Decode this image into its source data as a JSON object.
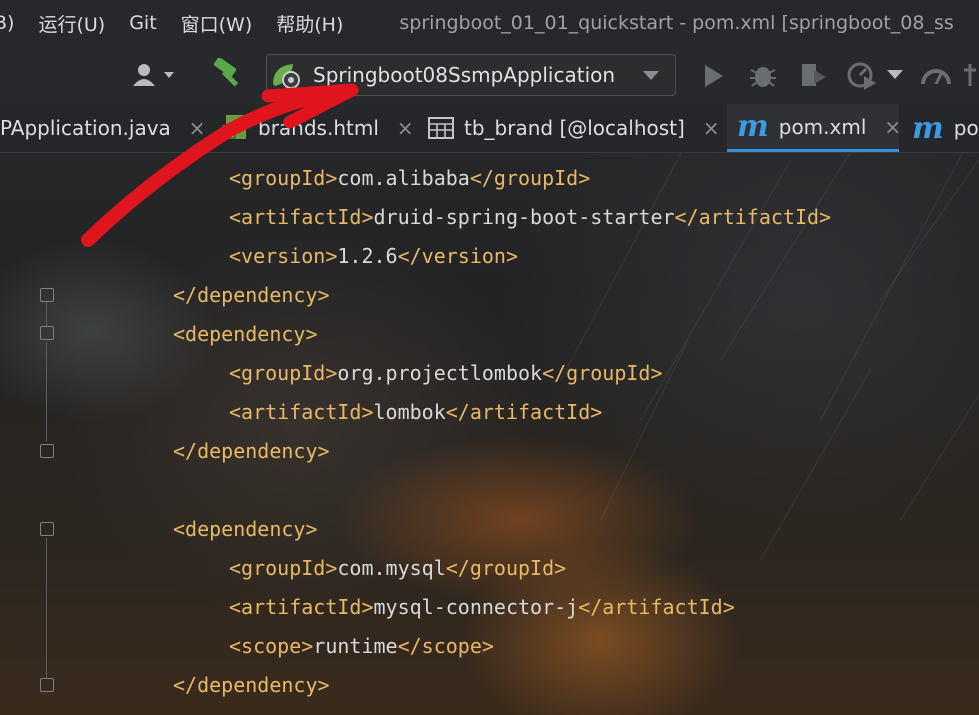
{
  "menubar": {
    "items": [
      {
        "label": "B)"
      },
      {
        "label": "运行(U)"
      },
      {
        "label": "Git"
      },
      {
        "label": "窗口(W)"
      },
      {
        "label": "帮助(H)"
      }
    ],
    "window_title": "springboot_01_01_quickstart - pom.xml [springboot_08_ss"
  },
  "toolbar": {
    "run_config": "Springboot08SsmpApplication",
    "icons": [
      "user-icon",
      "build-hammer-icon",
      "spring-boot-icon",
      "run-icon",
      "debug-icon",
      "coverage-icon",
      "profiler-icon",
      "more-run-icon",
      "performance-icon",
      "settings-icon"
    ]
  },
  "tabs": [
    {
      "label": "PApplication.java",
      "icon": "java-file-icon",
      "active": false
    },
    {
      "label": "brands.html",
      "icon": "html-file-icon",
      "active": false
    },
    {
      "label": "tb_brand [@localhost]",
      "icon": "table-icon",
      "active": false
    },
    {
      "label": "pom.xml",
      "icon": "maven-icon",
      "active": true
    },
    {
      "label": "pom",
      "icon": "maven-icon",
      "active": false
    }
  ],
  "tab_close": "×",
  "code": {
    "lines": [
      {
        "indent": 2,
        "open": "<groupId>",
        "text": "com.alibaba",
        "close": "</groupId>"
      },
      {
        "indent": 2,
        "open": "<artifactId>",
        "text": "druid-spring-boot-starter",
        "close": "</artifactId>"
      },
      {
        "indent": 2,
        "open": "<version>",
        "text": "1.2.6",
        "close": "</version>"
      },
      {
        "indent": 1,
        "open": "</dependency>",
        "text": "",
        "close": ""
      },
      {
        "indent": 1,
        "open": "<dependency>",
        "text": "",
        "close": ""
      },
      {
        "indent": 2,
        "open": "<groupId>",
        "text": "org.projectlombok",
        "close": "</groupId>"
      },
      {
        "indent": 2,
        "open": "<artifactId>",
        "text": "lombok",
        "close": "</artifactId>"
      },
      {
        "indent": 1,
        "open": "</dependency>",
        "text": "",
        "close": ""
      },
      {
        "indent": 0,
        "open": "",
        "text": "",
        "close": ""
      },
      {
        "indent": 1,
        "open": "<dependency>",
        "text": "",
        "close": ""
      },
      {
        "indent": 2,
        "open": "<groupId>",
        "text": "com.mysql",
        "close": "</groupId>"
      },
      {
        "indent": 2,
        "open": "<artifactId>",
        "text": "mysql-connector-j",
        "close": "</artifactId>"
      },
      {
        "indent": 2,
        "open": "<scope>",
        "text": "runtime",
        "close": "</scope>"
      },
      {
        "indent": 1,
        "open": "</dependency>",
        "text": "",
        "close": ""
      }
    ]
  },
  "colors": {
    "tag": "#e8b964",
    "text": "#d9d9d9",
    "accent": "#3b8fd6",
    "annotation_arrow": "#e0141c"
  }
}
